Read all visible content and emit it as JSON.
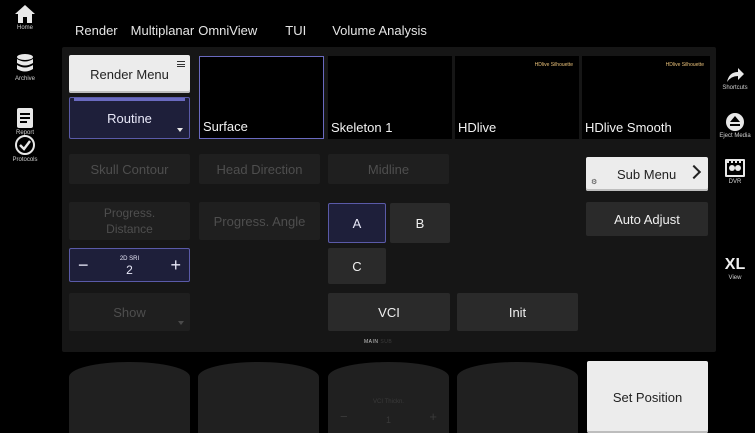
{
  "left_sidebar": [
    {
      "label": "Home",
      "icon": "home-icon"
    },
    {
      "label": "Archive",
      "icon": "archive-icon"
    },
    {
      "label": "Report",
      "icon": "report-icon"
    },
    {
      "label": "Protocols",
      "icon": "protocols-icon"
    }
  ],
  "right_sidebar": [
    {
      "label": "Shortcuts",
      "icon": "shortcuts-arrow-icon"
    },
    {
      "label": "Eject Media",
      "icon": "eject-icon"
    },
    {
      "label": "DVR",
      "icon": "dvr-icon"
    },
    {
      "label": "View",
      "icon": "xl-view-icon",
      "glyph": "XL"
    }
  ],
  "top_menu": [
    "Render",
    "Multiplanar",
    "OmniView",
    "TUI",
    "Volume Analysis"
  ],
  "render_menu": {
    "label": "Render Menu",
    "mode": "Routine"
  },
  "thumbnails": [
    {
      "label": "Surface",
      "tag": "",
      "selected": true
    },
    {
      "label": "Skeleton 1",
      "tag": "",
      "selected": false
    },
    {
      "label": "HDlive",
      "tag": "HDlive Silhouette",
      "selected": false
    },
    {
      "label": "HDlive Smooth",
      "tag": "HDlive Silhouette",
      "selected": false
    }
  ],
  "buttons": {
    "skull_contour": "Skull Contour",
    "head_direction": "Head Direction",
    "midline": "Midline",
    "progress_distance": "Progress. Distance",
    "progress_angle": "Progress. Angle",
    "a": "A",
    "b": "B",
    "c": "C",
    "show": "Show",
    "vci": "VCI",
    "init": "Init",
    "sub_menu": "Sub Menu",
    "auto_adjust": "Auto Adjust",
    "set_position": "Set Position"
  },
  "sri": {
    "label": "2D SRI",
    "value": "2",
    "minus": "−",
    "plus": "+"
  },
  "page_indicator": {
    "active": "MAIN",
    "inactive": "SUB"
  },
  "knobs": [
    {
      "label": "",
      "value": ""
    },
    {
      "label": "",
      "value": ""
    },
    {
      "label": "VCI Thickn.",
      "value": "1",
      "minus": "−",
      "plus": "+"
    },
    {
      "label": "",
      "value": ""
    }
  ],
  "colors": {
    "accent_border": "#5a5aa8",
    "navy_button": "#1e1f3a",
    "tag_color": "#e9c079"
  }
}
